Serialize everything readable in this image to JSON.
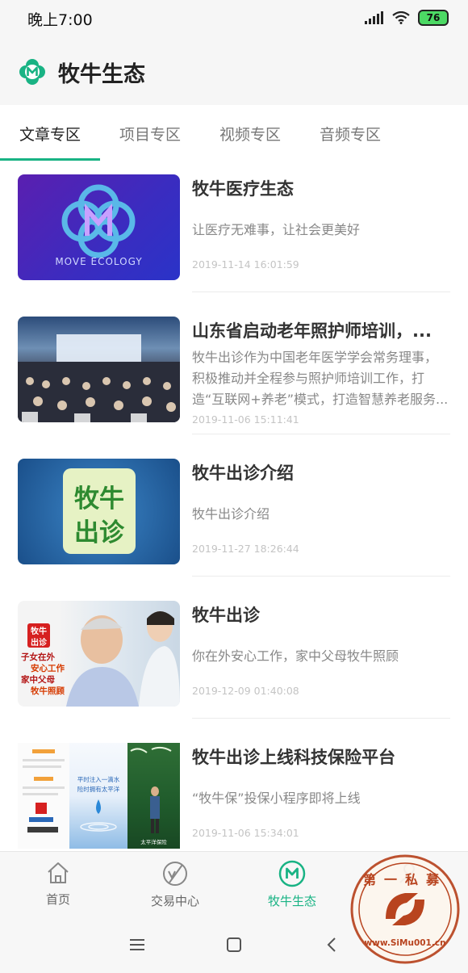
{
  "status_bar": {
    "time": "晚上7:00",
    "battery": "76"
  },
  "header": {
    "title": "牧牛生态",
    "logo_icon": "clover-m-logo-icon",
    "brand_color": "#19b384"
  },
  "tabs": [
    {
      "label": "文章专区",
      "active": true
    },
    {
      "label": "项目专区",
      "active": false
    },
    {
      "label": "视频专区",
      "active": false
    },
    {
      "label": "音频专区",
      "active": false
    }
  ],
  "articles": [
    {
      "title": "牧牛医疗生态",
      "desc": "让医疗无难事，让社会更美好",
      "date": "2019-11-14 16:01:59",
      "thumb_text": "MOVE ECOLOGY"
    },
    {
      "title": "山东省启动老年照护师培训，...",
      "desc": "牧牛出诊作为中国老年医学学会常务理事，积极推动并全程参与照护师培训工作，打造“互联网+养老”模式，打造智慧养老服务...",
      "date": "2019-11-06 15:11:41"
    },
    {
      "title": "牧牛出诊介绍",
      "desc": "牧牛出诊介绍",
      "date": "2019-11-27 18:26:44",
      "thumb_text_1": "牧牛",
      "thumb_text_2": "出诊"
    },
    {
      "title": "牧牛出诊",
      "desc": "你在外安心工作，家中父母牧牛照顾",
      "date": "2019-12-09 01:40:08",
      "thumb_badge_1": "牧牛",
      "thumb_badge_2": "出诊",
      "thumb_lines": [
        "子女在外",
        "安心工作",
        "家中父母",
        "牧牛照顾"
      ]
    },
    {
      "title": "牧牛出诊上线科技保险平台",
      "desc": "“牧牛保”投保小程序即将上线",
      "date": "2019-11-06 15:34:01",
      "thumb_text_1": "平时注入一滴水",
      "thumb_text_2": "险时拥有太平洋",
      "thumb_text_3": "太平洋保险"
    }
  ],
  "tabbar": [
    {
      "label": "首页",
      "icon": "home-icon",
      "active": false
    },
    {
      "label": "交易中心",
      "icon": "trade-icon",
      "active": false
    },
    {
      "label": "牧牛生态",
      "icon": "ecology-m-icon",
      "active": true
    },
    {
      "label": "",
      "icon": "profile-icon",
      "active": false
    }
  ],
  "navbar": {
    "menu_icon": "menu-icon",
    "home_icon": "square-home-icon",
    "back_icon": "back-icon"
  },
  "watermark": {
    "text_top": "第一私募",
    "text_bottom": "www.SiMu001.cn"
  }
}
